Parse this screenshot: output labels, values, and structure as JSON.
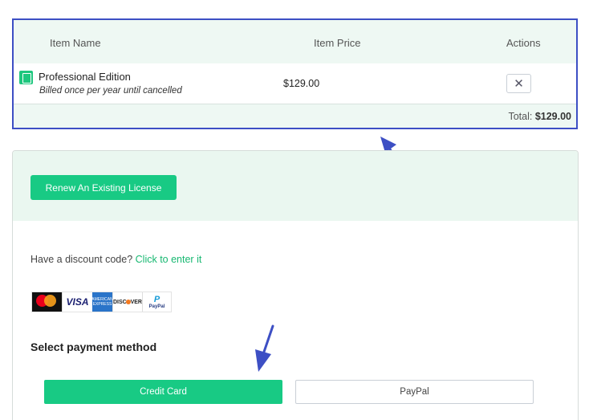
{
  "cart": {
    "columns": {
      "name": "Item Name",
      "price": "Item Price",
      "actions": "Actions"
    },
    "item": {
      "icon": "license-icon",
      "name": "Professional Edition",
      "subtitle": "Billed once per year until cancelled",
      "price": "$129.00",
      "remove_icon": "✕"
    },
    "total_label": "Total:",
    "total_value": "$129.00"
  },
  "checkout": {
    "renew_label": "Renew An Existing License",
    "discount_prompt": "Have a discount code?",
    "discount_link": "Click to enter it",
    "cards": {
      "visa": "VISA",
      "amex": "AMERICAN EXPRESS",
      "discover": "DISC",
      "discover_tail": "VER",
      "paypal": "PayPal"
    },
    "payment_method_title": "Select payment method",
    "methods": {
      "credit_card": "Credit Card",
      "paypal": "PayPal"
    }
  },
  "colors": {
    "accent": "#18ca84",
    "annotation": "#3d4fc4"
  }
}
